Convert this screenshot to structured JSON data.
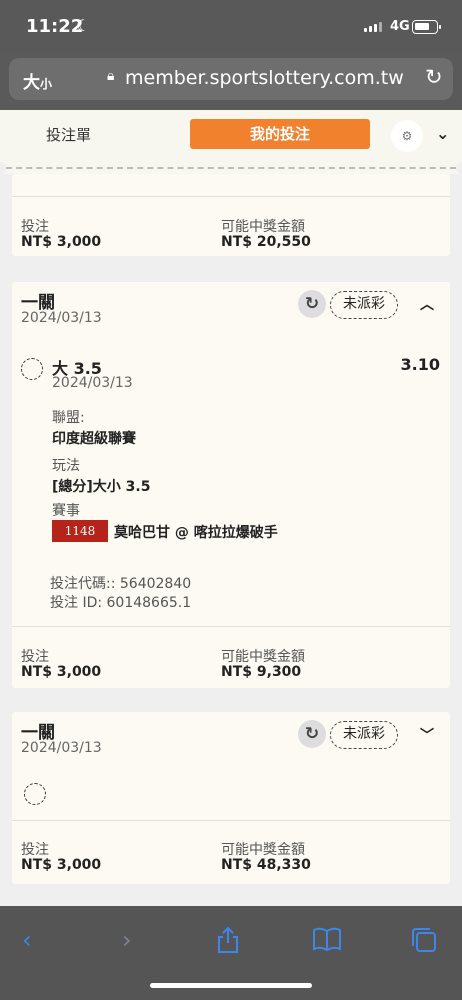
{
  "status": {
    "time": "11:22",
    "network": "4G"
  },
  "browser": {
    "text_size_btn": "大",
    "text_size_small": "小",
    "url": "member.sportslottery.com.tw"
  },
  "header": {
    "tab_betslip": "投注單",
    "tab_mybets": "我的投注"
  },
  "partial_card": {
    "stake_label": "投注",
    "stake": "NT$ 3,000",
    "payout_label": "可能中獎金額",
    "payout": "NT$ 20,550"
  },
  "bet1": {
    "title": "一關",
    "date": "2024/03/13",
    "status": "未派彩",
    "selection": "大 3.5",
    "odds": "3.10",
    "selection_date": "2024/03/13",
    "league_label": "聯盟:",
    "league": "印度超級聯賽",
    "market_label": "玩法",
    "market": "[總分]大小 3.5",
    "event_label": "賽事",
    "event_code": "1148",
    "event": "莫哈巴甘 @ 喀拉拉爆破手",
    "bet_code": "投注代碼:: 56402840",
    "bet_id": "投注 ID: 60148665.1",
    "stake_label": "投注",
    "stake": "NT$ 3,000",
    "payout_label": "可能中獎金額",
    "payout": "NT$ 9,300"
  },
  "bet2": {
    "title": "一關",
    "date": "2024/03/13",
    "status": "未派彩",
    "stake_label": "投注",
    "stake": "NT$ 3,000",
    "payout_label": "可能中獎金額",
    "payout": "NT$ 48,330"
  },
  "toolbar_icons": [
    "back-icon",
    "forward-icon",
    "share-icon",
    "bookmarks-icon",
    "tabs-icon"
  ]
}
